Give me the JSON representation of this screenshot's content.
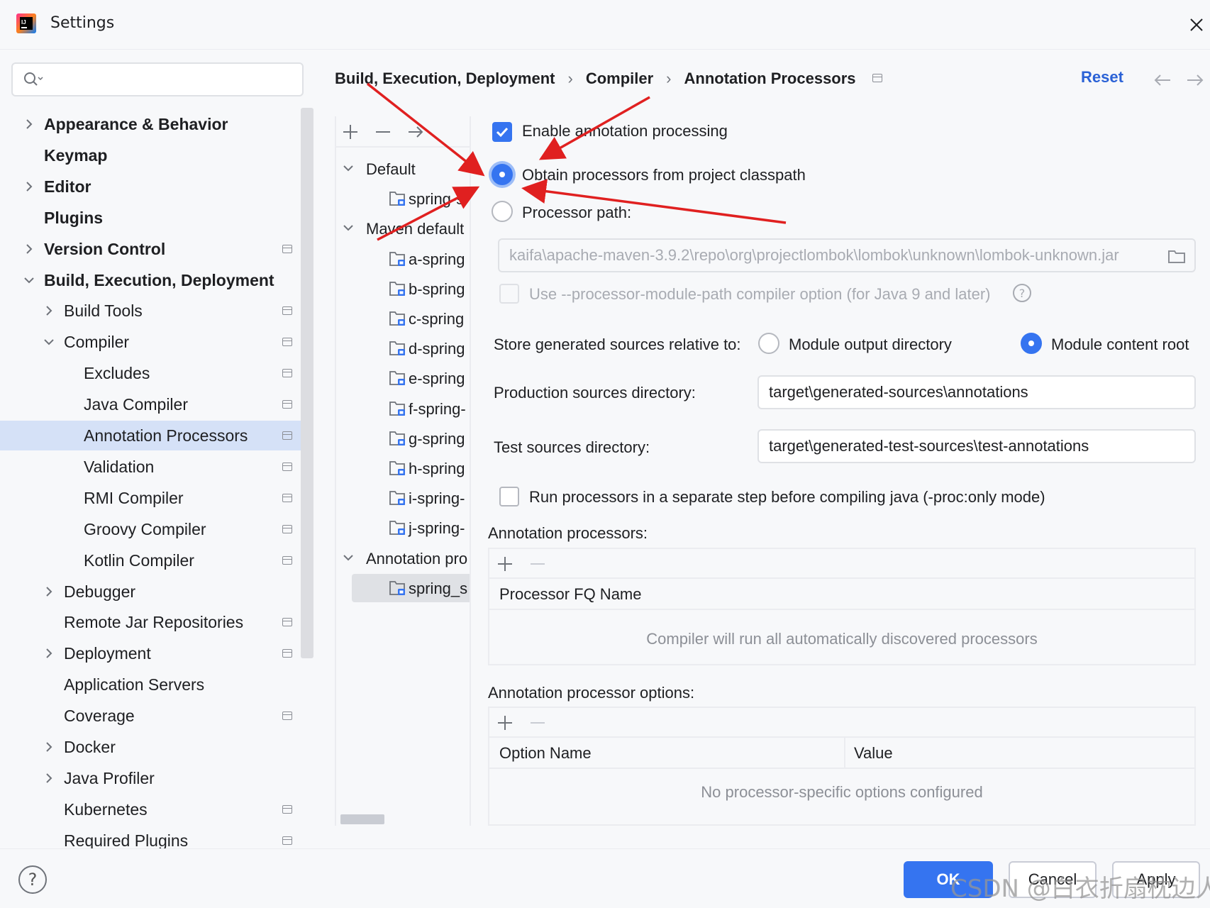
{
  "window": {
    "title": "Settings",
    "close_glyph": "✕"
  },
  "search": {
    "placeholder": ""
  },
  "sidebar": {
    "items": [
      {
        "label": "Appearance & Behavior",
        "bold": true,
        "level": 0,
        "expandable": true,
        "expanded": false,
        "pin": false
      },
      {
        "label": "Keymap",
        "bold": true,
        "level": 0,
        "expandable": false,
        "pin": false
      },
      {
        "label": "Editor",
        "bold": true,
        "level": 0,
        "expandable": true,
        "expanded": false,
        "pin": false
      },
      {
        "label": "Plugins",
        "bold": true,
        "level": 0,
        "expandable": false,
        "pin": false
      },
      {
        "label": "Version Control",
        "bold": true,
        "level": 0,
        "expandable": true,
        "expanded": false,
        "pin": true
      },
      {
        "label": "Build, Execution, Deployment",
        "bold": true,
        "level": 0,
        "expandable": true,
        "expanded": true,
        "pin": false
      },
      {
        "label": "Build Tools",
        "bold": false,
        "level": 1,
        "expandable": true,
        "expanded": false,
        "pin": true
      },
      {
        "label": "Compiler",
        "bold": false,
        "level": 1,
        "expandable": true,
        "expanded": true,
        "pin": true
      },
      {
        "label": "Excludes",
        "bold": false,
        "level": 2,
        "expandable": false,
        "pin": true
      },
      {
        "label": "Java Compiler",
        "bold": false,
        "level": 2,
        "expandable": false,
        "pin": true
      },
      {
        "label": "Annotation Processors",
        "bold": false,
        "level": 2,
        "expandable": false,
        "pin": true,
        "selected": true
      },
      {
        "label": "Validation",
        "bold": false,
        "level": 2,
        "expandable": false,
        "pin": true
      },
      {
        "label": "RMI Compiler",
        "bold": false,
        "level": 2,
        "expandable": false,
        "pin": true
      },
      {
        "label": "Groovy Compiler",
        "bold": false,
        "level": 2,
        "expandable": false,
        "pin": true
      },
      {
        "label": "Kotlin Compiler",
        "bold": false,
        "level": 2,
        "expandable": false,
        "pin": true
      },
      {
        "label": "Debugger",
        "bold": false,
        "level": 1,
        "expandable": true,
        "expanded": false,
        "pin": false
      },
      {
        "label": "Remote Jar Repositories",
        "bold": false,
        "level": 1,
        "expandable": false,
        "pin": true
      },
      {
        "label": "Deployment",
        "bold": false,
        "level": 1,
        "expandable": true,
        "expanded": false,
        "pin": true
      },
      {
        "label": "Application Servers",
        "bold": false,
        "level": 1,
        "expandable": false,
        "pin": false
      },
      {
        "label": "Coverage",
        "bold": false,
        "level": 1,
        "expandable": false,
        "pin": true
      },
      {
        "label": "Docker",
        "bold": false,
        "level": 1,
        "expandable": true,
        "expanded": false,
        "pin": false
      },
      {
        "label": "Java Profiler",
        "bold": false,
        "level": 1,
        "expandable": true,
        "expanded": false,
        "pin": false
      },
      {
        "label": "Kubernetes",
        "bold": false,
        "level": 1,
        "expandable": false,
        "pin": true
      },
      {
        "label": "Required Plugins",
        "bold": false,
        "level": 1,
        "expandable": false,
        "pin": true
      }
    ]
  },
  "breadcrumb": {
    "parts": [
      "Build, Execution, Deployment",
      "Compiler",
      "Annotation Processors"
    ],
    "separator": "›",
    "reset": "Reset"
  },
  "profiles": {
    "items": [
      {
        "label": "Default",
        "type": "group"
      },
      {
        "label": "spring-s",
        "type": "module"
      },
      {
        "label": "Maven default",
        "type": "group"
      },
      {
        "label": "a-spring",
        "type": "module"
      },
      {
        "label": "b-spring",
        "type": "module"
      },
      {
        "label": "c-spring",
        "type": "module"
      },
      {
        "label": "d-spring",
        "type": "module"
      },
      {
        "label": "e-spring",
        "type": "module"
      },
      {
        "label": "f-spring-",
        "type": "module"
      },
      {
        "label": "g-spring",
        "type": "module"
      },
      {
        "label": "h-spring",
        "type": "module"
      },
      {
        "label": "i-spring-",
        "type": "module"
      },
      {
        "label": "j-spring-",
        "type": "module"
      },
      {
        "label": "Annotation pro",
        "type": "group"
      },
      {
        "label": "spring_s",
        "type": "module",
        "selected": true
      }
    ]
  },
  "settings": {
    "enable_processing": {
      "label": "Enable annotation processing",
      "checked": true
    },
    "obtain_classpath": {
      "label": "Obtain processors from project classpath",
      "selected": true
    },
    "processor_path": {
      "label": "Processor path:",
      "selected": false,
      "value": "kaifa\\apache-maven-3.9.2\\repo\\org\\projectlombok\\lombok\\unknown\\lombok-unknown.jar"
    },
    "module_path_option": {
      "label": "Use --processor-module-path compiler option (for Java 9 and later)",
      "checked": false,
      "help_glyph": "?"
    },
    "store_relative": {
      "label": "Store generated sources relative to:",
      "options": [
        "Module output directory",
        "Module content root"
      ],
      "selected": "Module content root"
    },
    "production_dir": {
      "label": "Production sources directory:",
      "value": "target\\generated-sources\\annotations"
    },
    "test_dir": {
      "label": "Test sources directory:",
      "value": "target\\generated-test-sources\\test-annotations"
    },
    "separate_step": {
      "label": "Run processors in a separate step before compiling java (-proc:only mode)",
      "checked": false
    },
    "processors_table": {
      "title": "Annotation processors:",
      "columns": [
        "Processor FQ Name"
      ],
      "empty_text": "Compiler will run all automatically discovered processors"
    },
    "options_table": {
      "title": "Annotation processor options:",
      "columns": [
        "Option Name",
        "Value"
      ],
      "empty_text": "No processor-specific options configured"
    }
  },
  "buttons": {
    "ok": "OK",
    "cancel": "Cancel",
    "apply": "Apply",
    "help": "?"
  },
  "watermark": "CSDN @白衣折扇枕边人",
  "colors": {
    "accent": "#3574f0",
    "selection": "#d5e1f7",
    "annotation_arrow": "#e02020",
    "link": "#2b62d6"
  }
}
